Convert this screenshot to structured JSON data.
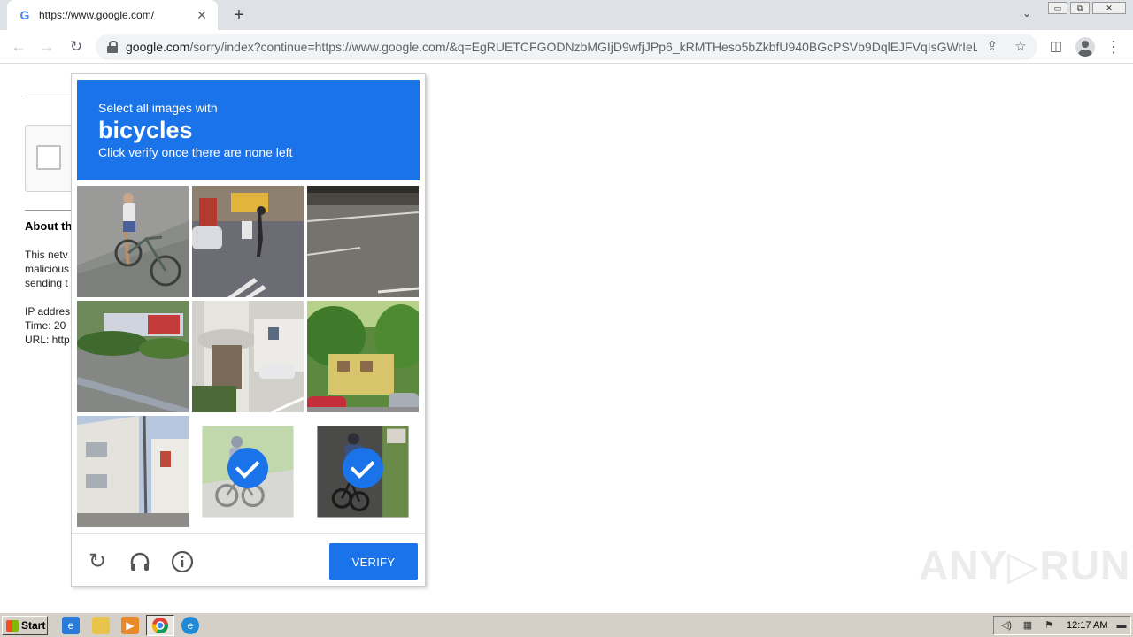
{
  "browser": {
    "tab": {
      "title": "https://www.google.com/",
      "favicon": "G",
      "close": "✕"
    },
    "new_tab": "+",
    "tab_search": "⌄",
    "url_host": "google.com",
    "url_path": "/sorry/index?continue=https://www.google.com/&q=EgRUETCFGODNzbMGIjD9wfjJPp6_kRMTHeso5bZkbfU940BGcPSVb9DqlEJFVqIsGWrIeLui...",
    "nav": {
      "back": "←",
      "forward": "→",
      "reload": "↻"
    },
    "toolbar": {
      "share": "⇪",
      "bookmark": "☆",
      "side_panel": "◫",
      "menu": "⋮"
    },
    "window": {
      "minimize": "▭",
      "restore": "⧉",
      "close": "✕"
    }
  },
  "background_page": {
    "about_heading": "About th",
    "lines": [
      "This netv",
      "malicious",
      "sending t",
      "",
      "IP addres",
      "Time: 20",
      "URL: http"
    ]
  },
  "captcha": {
    "instruction_line1": "Select all images with",
    "target_object": "bicycles",
    "instruction_line3": "Click verify once there are none left",
    "tiles": [
      {
        "description": "cyclist-on-road",
        "selected": false
      },
      {
        "description": "street-pedestrian",
        "selected": false
      },
      {
        "description": "empty-parking-lot",
        "selected": false
      },
      {
        "description": "roadside-hedge",
        "selected": false
      },
      {
        "description": "apartment-entrance",
        "selected": false
      },
      {
        "description": "house-with-trees",
        "selected": false
      },
      {
        "description": "white-buildings",
        "selected": false
      },
      {
        "description": "cyclist-faded",
        "selected": true
      },
      {
        "description": "cyclist-dark-road",
        "selected": true
      }
    ],
    "verify_label": "VERIFY",
    "accent_color": "#1a73e8"
  },
  "watermark": "ANY▷RUN",
  "taskbar": {
    "start_label": "Start",
    "clock": "12:17 AM"
  }
}
